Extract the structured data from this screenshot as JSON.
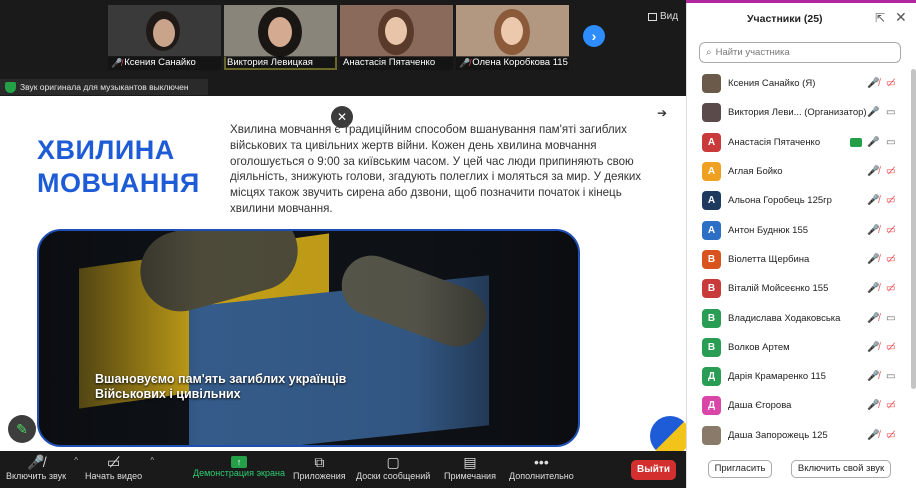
{
  "window": {
    "view_label": "Вид"
  },
  "thumbnails": [
    {
      "name": "Ксения Санайко",
      "muted": true
    },
    {
      "name": "Виктория Левицкая",
      "muted": false
    },
    {
      "name": "Анастасія Пятаченко",
      "muted": false
    },
    {
      "name": "Олена Коробкова 115",
      "muted": true
    }
  ],
  "notice": {
    "text": "Звук оригинала для музыкантов выключен"
  },
  "slide": {
    "title": "ХВИЛИНА МОВЧАННЯ",
    "body": "Хвилина мовчання є традиційним способом вшанування пам'яті загиблих військових та цивільних жертв війни. Кожен день хвилина мовчання оголошується о 9:00 за київським часом. У цей час люди припиняють свою діяльність, знижують голови, згадують полеглих і моляться за мир. У деяких місцях також звучить сирена або дзвони, щоб позначити початок і кінець хвилини мовчання.",
    "video_caption_line1": "Вшановуємо пам'ять загиблих українців",
    "video_caption_line2": "Військових і цивільних"
  },
  "toolbar": {
    "audio": "Включить звук",
    "video": "Начать видео",
    "share": "Демонстрация экрана",
    "apps": "Приложения",
    "whiteboards": "Доски сообщений",
    "notes": "Примечания",
    "more": "Дополнительно",
    "leave": "Выйти"
  },
  "panel": {
    "title": "Участники (25)",
    "search_placeholder": "Найти участника",
    "invite": "Пригласить",
    "unmute_me": "Включить свой звук",
    "participants": [
      {
        "name": "Ксения Санайко (Я)",
        "initial": "",
        "photo": true,
        "color": "#6b5a4a",
        "mic": "muted",
        "cam": "off"
      },
      {
        "name": "Виктория Леви... (Организатор)",
        "initial": "",
        "photo": true,
        "color": "#5a4a4a",
        "mic": "on",
        "cam": "on"
      },
      {
        "name": "Анастасія Пятаченко",
        "initial": "А",
        "photo": false,
        "color": "#c93a3a",
        "mic": "on",
        "cam": "on",
        "sharing": true
      },
      {
        "name": "Аглая Бойко",
        "initial": "А",
        "photo": false,
        "color": "#f0a020",
        "mic": "muted",
        "cam": "off"
      },
      {
        "name": "Альона Горобець 125гр",
        "initial": "А",
        "photo": false,
        "color": "#1e3a5f",
        "mic": "muted",
        "cam": "off"
      },
      {
        "name": "Антон Буднюк 155",
        "initial": "А",
        "photo": false,
        "color": "#2d6fc4",
        "mic": "muted",
        "cam": "off"
      },
      {
        "name": "Віолетта Щербина",
        "initial": "В",
        "photo": false,
        "color": "#d9531e",
        "mic": "muted",
        "cam": "off"
      },
      {
        "name": "Віталій Мойсеєнко 155",
        "initial": "В",
        "photo": false,
        "color": "#c93a3a",
        "mic": "muted",
        "cam": "off"
      },
      {
        "name": "Владислава Ходаковська",
        "initial": "В",
        "photo": false,
        "color": "#2a9d55",
        "mic": "muted",
        "cam": "on"
      },
      {
        "name": "Волков Артем",
        "initial": "В",
        "photo": false,
        "color": "#2a9d55",
        "mic": "muted",
        "cam": "off"
      },
      {
        "name": "Дарія Крамаренко 115",
        "initial": "Д",
        "photo": false,
        "color": "#2a9d55",
        "mic": "muted",
        "cam": "on"
      },
      {
        "name": "Даша Єгорова",
        "initial": "Д",
        "photo": false,
        "color": "#d946a8",
        "mic": "muted",
        "cam": "off"
      },
      {
        "name": "Даша Запорожець 125",
        "initial": "",
        "photo": true,
        "color": "#8a7a6a",
        "mic": "muted",
        "cam": "off"
      }
    ]
  }
}
